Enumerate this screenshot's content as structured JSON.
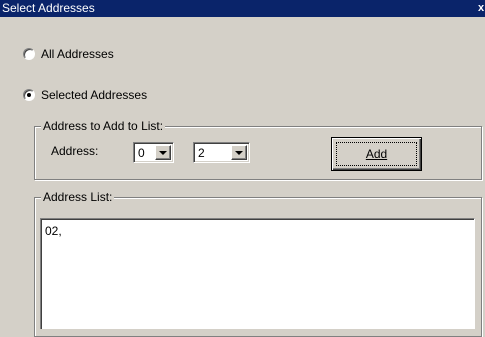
{
  "window": {
    "title": "Select Addresses",
    "close_glyph": "x"
  },
  "mode": {
    "options": [
      {
        "label": "All Addresses",
        "selected": false
      },
      {
        "label": "Selected Addresses",
        "selected": true
      }
    ]
  },
  "add_group": {
    "legend": "Address to Add to List:",
    "address_label": "Address:",
    "digit1": "0",
    "digit2": "2",
    "add_label": "Add"
  },
  "list_group": {
    "legend": "Address List:",
    "content": "02,"
  },
  "icons": {
    "close": "close-icon",
    "dropdown": "chevron-down-icon"
  },
  "colors": {
    "titlebar": "#0a246a",
    "face": "#d4d0c8"
  }
}
